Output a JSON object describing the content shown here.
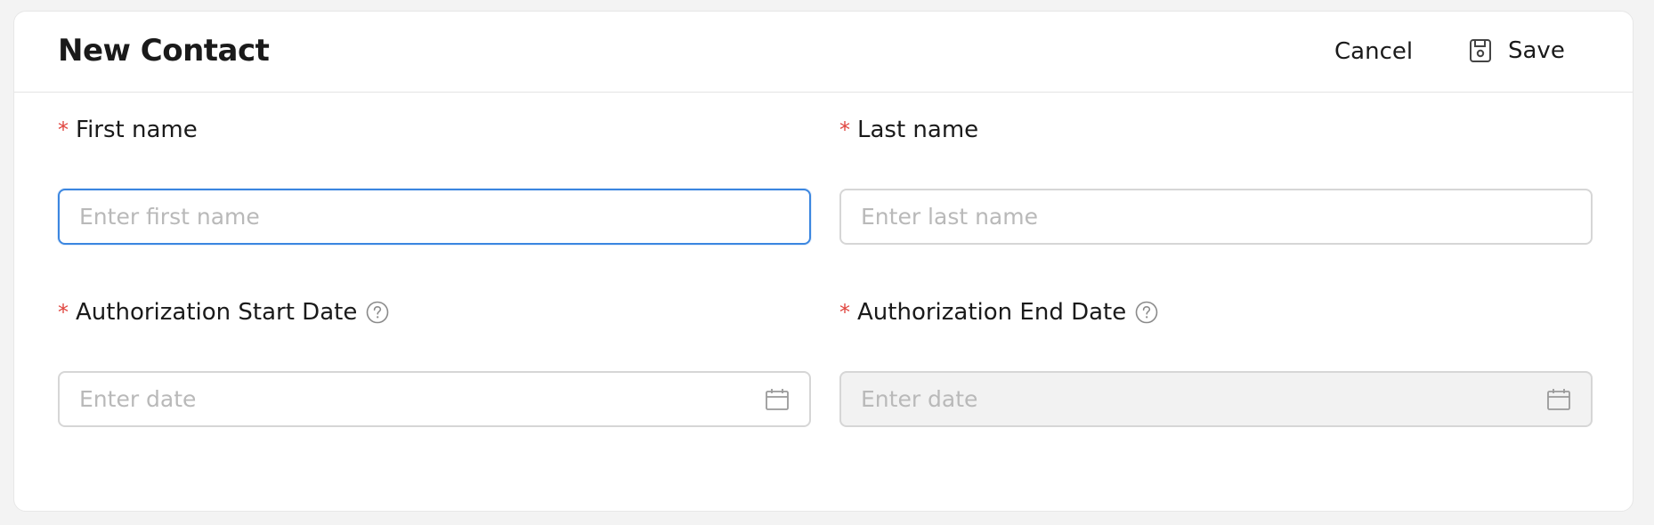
{
  "header": {
    "title": "New Contact",
    "cancel_label": "Cancel",
    "save_label": "Save"
  },
  "form": {
    "first_name": {
      "label": "First name",
      "required_mark": "*",
      "placeholder": "Enter first name",
      "value": ""
    },
    "last_name": {
      "label": "Last name",
      "required_mark": "*",
      "placeholder": "Enter last name",
      "value": ""
    },
    "auth_start": {
      "label": "Authorization Start Date",
      "required_mark": "*",
      "placeholder": "Enter date",
      "value": "",
      "icon": "calendar-icon",
      "help_icon": "question-circle-icon"
    },
    "auth_end": {
      "label": "Authorization End Date",
      "required_mark": "*",
      "placeholder": "Enter date",
      "value": "",
      "icon": "calendar-icon",
      "help_icon": "question-circle-icon",
      "disabled": true
    }
  },
  "colors": {
    "required": "#e0453f",
    "focus_border": "#3b86e0",
    "placeholder": "#b9b9b9",
    "disabled_bg": "#f2f2f2"
  }
}
